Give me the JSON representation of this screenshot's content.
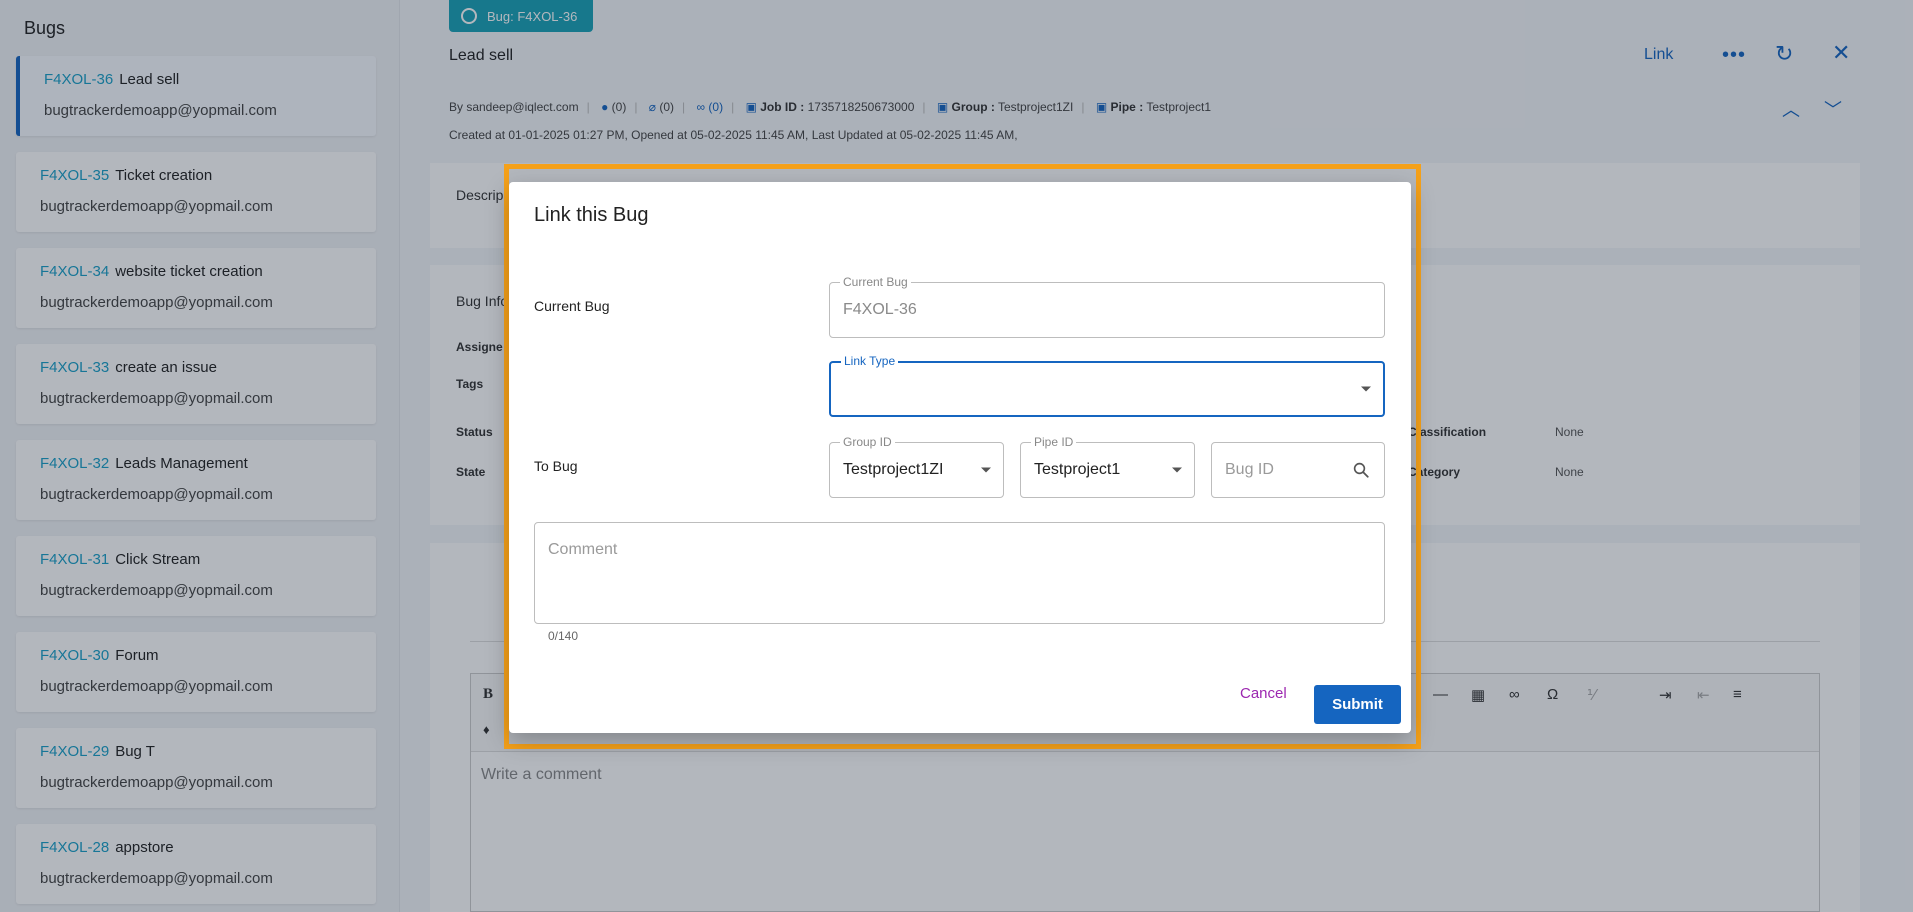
{
  "sidebar": {
    "title": "Bugs",
    "items": [
      {
        "id": "F4XOL-36",
        "title": "Lead sell",
        "email": "bugtrackerdemoapp@yopmail.com"
      },
      {
        "id": "F4XOL-35",
        "title": "Ticket creation",
        "email": "bugtrackerdemoapp@yopmail.com"
      },
      {
        "id": "F4XOL-34",
        "title": "website ticket creation",
        "email": "bugtrackerdemoapp@yopmail.com"
      },
      {
        "id": "F4XOL-33",
        "title": "create an issue",
        "email": "bugtrackerdemoapp@yopmail.com"
      },
      {
        "id": "F4XOL-32",
        "title": "Leads Management",
        "email": "bugtrackerdemoapp@yopmail.com"
      },
      {
        "id": "F4XOL-31",
        "title": "Click Stream",
        "email": "bugtrackerdemoapp@yopmail.com"
      },
      {
        "id": "F4XOL-30",
        "title": "Forum",
        "email": "bugtrackerdemoapp@yopmail.com"
      },
      {
        "id": "F4XOL-29",
        "title": "Bug T",
        "email": "bugtrackerdemoapp@yopmail.com"
      },
      {
        "id": "F4XOL-28",
        "title": "appstore",
        "email": "bugtrackerdemoapp@yopmail.com"
      }
    ]
  },
  "header": {
    "chip": "Bug: F4XOL-36",
    "title": "Lead sell",
    "link_label": "Link",
    "more_icon": "more-horizontal-icon",
    "refresh_icon": "refresh-icon",
    "close_icon": "close-icon"
  },
  "meta": {
    "by": "By sandeep@iqlect.com",
    "comments": "(0)",
    "attachments": "(0)",
    "links": "(0)",
    "job_label": "Job ID :",
    "job_id": "1735718250673000",
    "group_label": "Group :",
    "group": "Testproject1ZI",
    "pipe_label": "Pipe :",
    "pipe": "Testproject1",
    "dates": "Created at 01-01-2025 01:27 PM,   Opened at 05-02-2025 11:45 AM,   Last Updated at 05-02-2025 11:45 AM,"
  },
  "background": {
    "desc_label": "Descrip",
    "info_label": "Bug Info",
    "assignee": "Assigne",
    "tags": "Tags",
    "status": "Status",
    "state": "State",
    "classification": "Classification",
    "category": "Category",
    "none1": "None",
    "none2": "None",
    "editor_placeholder": "Write a comment"
  },
  "dialog": {
    "title": "Link this Bug",
    "current_bug_label": "Current Bug",
    "current_bug_legend": "Current Bug",
    "current_bug_value": "F4XOL-36",
    "link_type_legend": "Link Type",
    "link_type_value": "",
    "to_bug_label": "To Bug",
    "group_legend": "Group ID",
    "group_value": "Testproject1ZI",
    "pipe_legend": "Pipe ID",
    "pipe_value": "Testproject1",
    "bug_id_placeholder": "Bug ID",
    "comment_placeholder": "Comment",
    "counter": "0/140",
    "cancel_label": "Cancel",
    "submit_label": "Submit"
  },
  "colors": {
    "accent": "#1565c0",
    "highlight": "#f5a11a",
    "cancel": "#9c27b0",
    "bug_id": "#1aa0c8"
  }
}
